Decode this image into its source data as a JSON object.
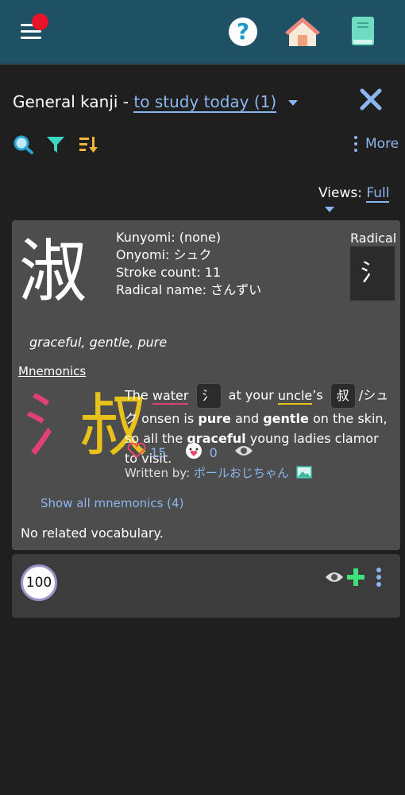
{
  "header": {
    "menu_icon": "hamburger-menu-icon",
    "help_icon": "question-mark-icon",
    "home_icon": "home-icon",
    "book_icon": "book-icon",
    "accent": "#1e5163",
    "notification_color": "#e8142a"
  },
  "title": {
    "prefix": "General kanji -",
    "filter_label": "to study today (1)"
  },
  "toolbar": {
    "search_icon": "search-icon",
    "filter_icon": "filter-icon",
    "sort_icon": "sort-icon",
    "more_label": "More"
  },
  "views": {
    "label": "Views:",
    "value": "Full"
  },
  "kanji": {
    "character": "淑",
    "kunyomi": "Kunyomi: (none)",
    "onyomi": "Onyomi: シュク",
    "stroke_count": "Stroke count: 11",
    "radical_name": "Radical name: さんずい",
    "radical_label": "Radical",
    "radical_char": "氵",
    "meanings": "graceful, gentle, pure"
  },
  "mnemonics": {
    "title": "Mnemonics",
    "kanji_left": "氵",
    "kanji_right": "叔",
    "left_color": "#e0407a",
    "right_color": "#e8c21a",
    "text": {
      "t1": "The",
      "water": "water",
      "chip1": "氵",
      "t2": "at your",
      "uncle": "uncle",
      "t3": "’s",
      "chip2": "叔",
      "t4": "/シュク onsen is",
      "pure": "pure",
      "t5": "and",
      "gentle": "gentle",
      "t6": "on the skin, so all the",
      "graceful": "graceful",
      "t7": "young ladies clamor to visit."
    },
    "likes": "15",
    "like_icon": "heart-icon",
    "reactions": "0",
    "reaction_icon": "face-heart-icon",
    "view_icon": "eye-icon",
    "written_by": "Written by:",
    "author": "ポールおじちゃん",
    "image_icon": "image-icon",
    "show_all": "Show all mnemonics (4)"
  },
  "vocabulary": {
    "empty_text": "No related vocabulary."
  },
  "footer_card": {
    "level": "100",
    "eye_icon": "eye-icon",
    "add_icon": "plus-icon",
    "more_icon": "vertical-dots-icon"
  }
}
